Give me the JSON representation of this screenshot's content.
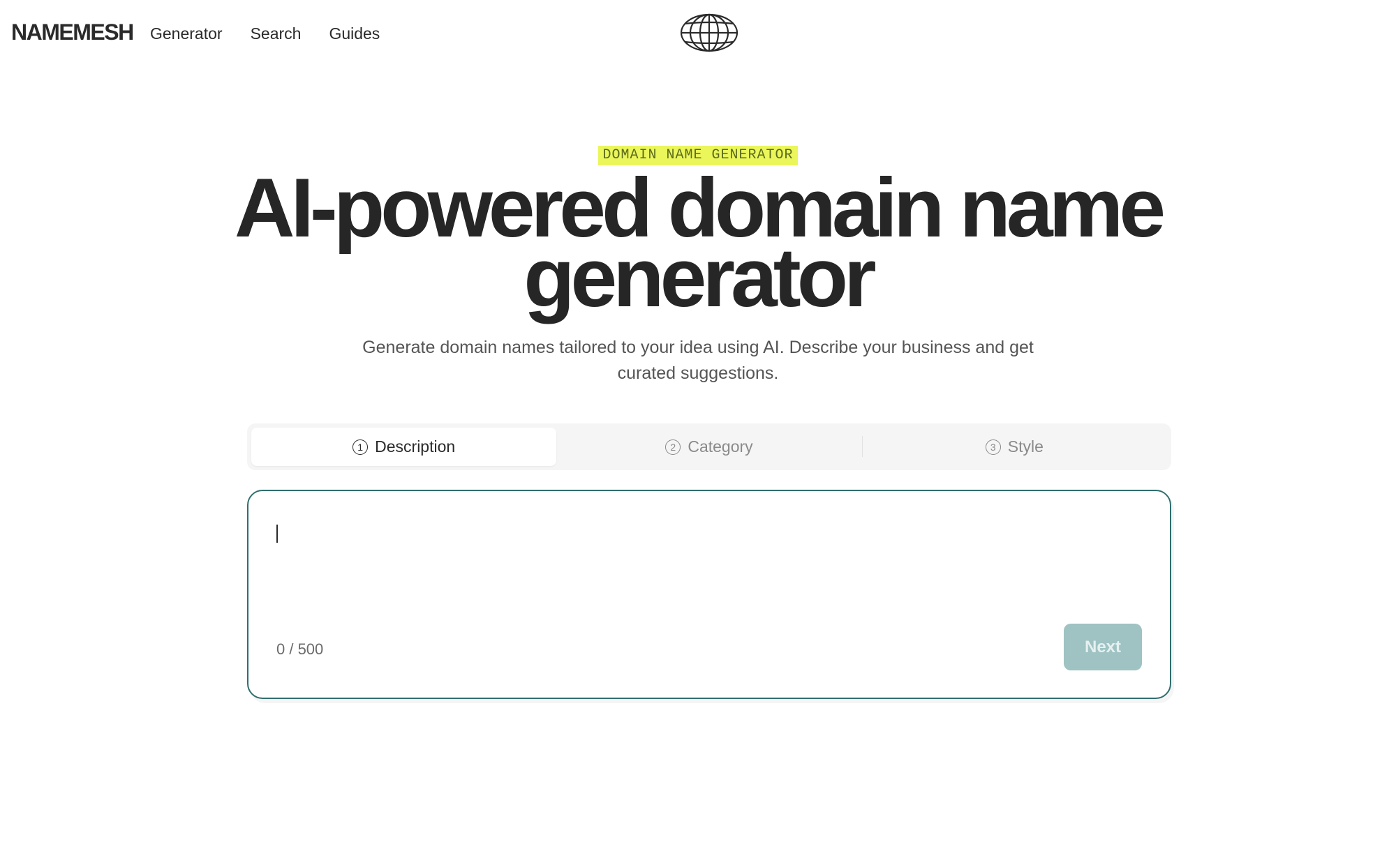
{
  "brand": {
    "logo": "NAMEMESH"
  },
  "nav": {
    "items": [
      {
        "label": "Generator"
      },
      {
        "label": "Search"
      },
      {
        "label": "Guides"
      }
    ]
  },
  "icons": {
    "center": "globe-icon"
  },
  "hero": {
    "eyebrow": "DOMAIN NAME GENERATOR",
    "title_line1": "AI-powered domain name",
    "title_line2": "generator",
    "subtitle_line1": "Generate domain names tailored to your idea using AI. Describe your business and get",
    "subtitle_line2": "curated suggestions."
  },
  "steps": [
    {
      "num": "1",
      "label": "Description",
      "active": true
    },
    {
      "num": "2",
      "label": "Category",
      "active": false
    },
    {
      "num": "3",
      "label": "Style",
      "active": false
    }
  ],
  "form": {
    "value": "",
    "placeholder": "",
    "counter": "0 / 500",
    "next_label": "Next"
  },
  "colors": {
    "eyebrow_bg": "#eaf65a",
    "card_border": "#2f6f6f",
    "next_bg_disabled": "#9fc2c2"
  }
}
